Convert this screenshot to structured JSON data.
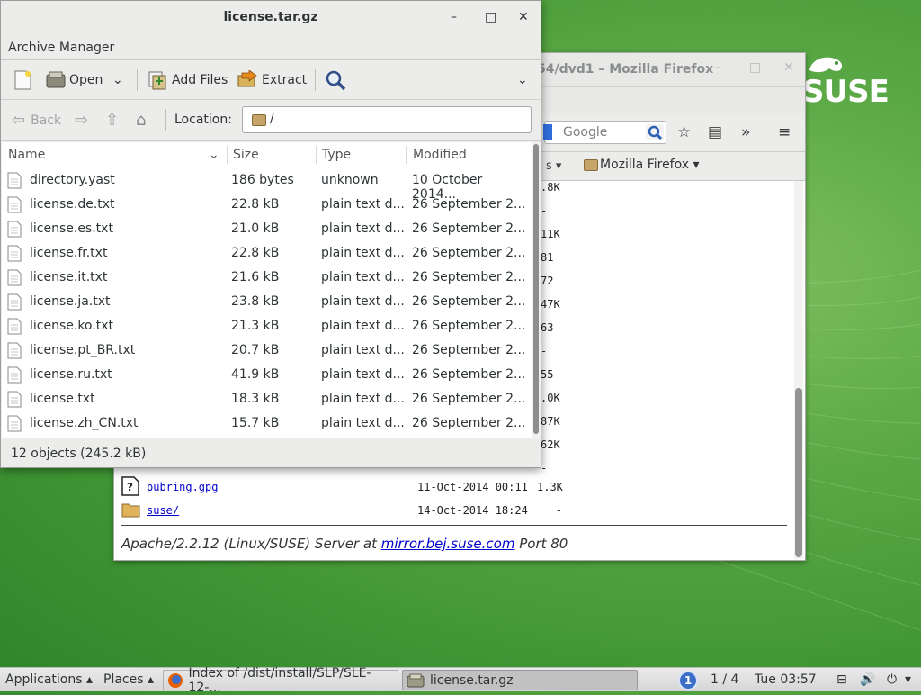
{
  "colors": {
    "desktop_green": "#3f9533",
    "link_blue": "#0000cc",
    "panel_bg": "#d6d6d6"
  },
  "desktop": {
    "logo_text": "SUSE"
  },
  "firefox": {
    "title": "54/dvd1 – Mozilla Firefox",
    "search_placeholder": "Google",
    "bookmark_partial": "s",
    "bookmark_folder": "Mozilla Firefox",
    "sizes_column": [
      ".8K",
      "-",
      "11K",
      "81",
      "72",
      "47K",
      "63",
      "-",
      "55",
      ".0K",
      "87K",
      "62K",
      "-"
    ],
    "rows": [
      {
        "name": "pubring.gpg",
        "date": "11-Oct-2014 00:11",
        "size": "1.3K",
        "icon": "unknown-file-icon"
      },
      {
        "name": "suse/",
        "date": "14-Oct-2014 18:24",
        "size": "-",
        "icon": "folder-icon"
      }
    ],
    "footer_prefix": "Apache/2.2.12 (Linux/SUSE) Server at ",
    "footer_link": "mirror.bej.suse.com",
    "footer_suffix": " Port 80"
  },
  "archive": {
    "title": "license.tar.gz",
    "menu_label": "Archive Manager",
    "toolbar": {
      "open": "Open",
      "add_files": "Add Files",
      "extract": "Extract"
    },
    "nav": {
      "back": "Back",
      "location_label": "Location:",
      "location_value": "/"
    },
    "columns": {
      "name": "Name",
      "size": "Size",
      "type": "Type",
      "modified": "Modified"
    },
    "files": [
      {
        "name": "directory.yast",
        "size": "186 bytes",
        "type": "unknown",
        "modified": "10 October 2014..."
      },
      {
        "name": "license.de.txt",
        "size": "22.8 kB",
        "type": "plain text d...",
        "modified": "26 September 2..."
      },
      {
        "name": "license.es.txt",
        "size": "21.0 kB",
        "type": "plain text d...",
        "modified": "26 September 2..."
      },
      {
        "name": "license.fr.txt",
        "size": "22.8 kB",
        "type": "plain text d...",
        "modified": "26 September 2..."
      },
      {
        "name": "license.it.txt",
        "size": "21.6 kB",
        "type": "plain text d...",
        "modified": "26 September 2..."
      },
      {
        "name": "license.ja.txt",
        "size": "23.8 kB",
        "type": "plain text d...",
        "modified": "26 September 2..."
      },
      {
        "name": "license.ko.txt",
        "size": "21.3 kB",
        "type": "plain text d...",
        "modified": "26 September 2..."
      },
      {
        "name": "license.pt_BR.txt",
        "size": "20.7 kB",
        "type": "plain text d...",
        "modified": "26 September 2..."
      },
      {
        "name": "license.ru.txt",
        "size": "41.9 kB",
        "type": "plain text d...",
        "modified": "26 September 2..."
      },
      {
        "name": "license.txt",
        "size": "18.3 kB",
        "type": "plain text d...",
        "modified": "26 September 2..."
      },
      {
        "name": "license.zh_CN.txt",
        "size": "15.7 kB",
        "type": "plain text d...",
        "modified": "26 September 2..."
      }
    ],
    "status": "12 objects (245.2 kB)"
  },
  "panel": {
    "applications": "Applications",
    "places": "Places",
    "task_firefox": "Index of /dist/install/SLP/SLE-12-...",
    "task_archive": "license.tar.gz",
    "notification_count": "1",
    "workspace": "1 / 4",
    "clock": "Tue 03:57"
  }
}
